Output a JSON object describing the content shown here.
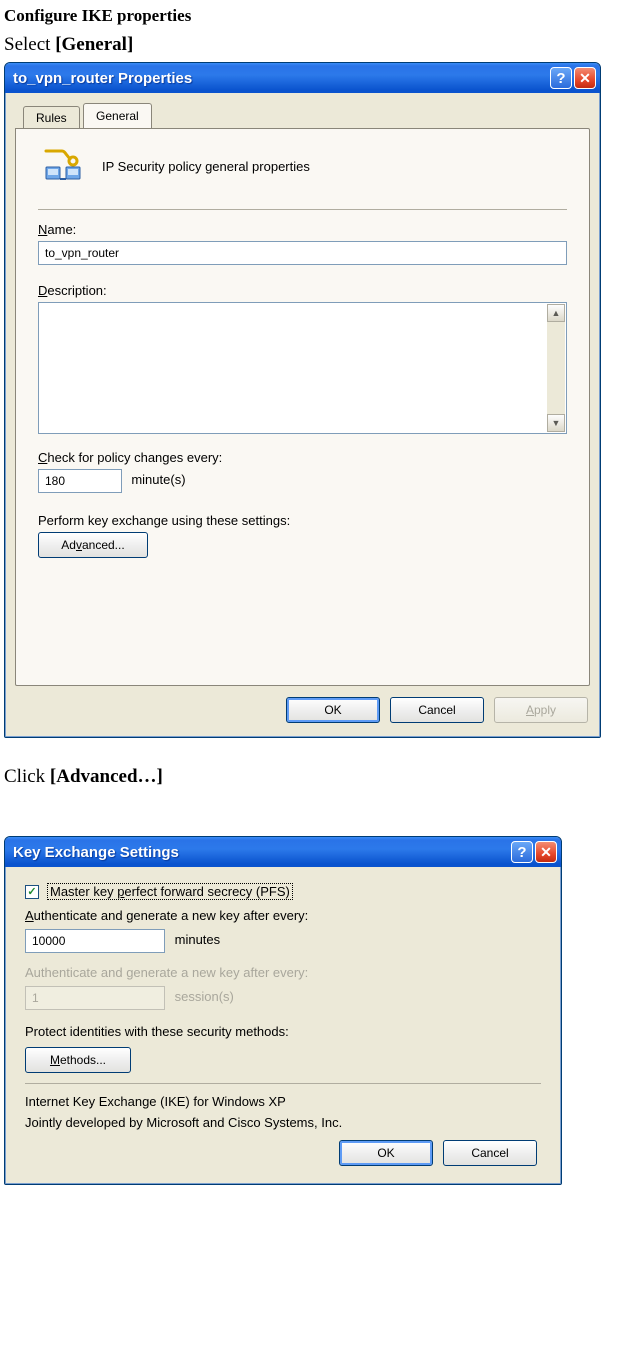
{
  "headings": {
    "configure": "Configure IKE properties",
    "select_prefix": "Select ",
    "select_bold": "[General]",
    "click_prefix": "Click ",
    "click_bold": "[Advanced…]"
  },
  "dlg1": {
    "title": "to_vpn_router Properties",
    "tabs": {
      "rules": "Rules",
      "general": "General"
    },
    "header_text": "IP Security policy general properties",
    "name_label_pre": "N",
    "name_label_rest": "ame:",
    "name_value": "to_vpn_router",
    "desc_label_pre": "D",
    "desc_label_rest": "escription:",
    "check_label_pre": "C",
    "check_label_rest": "heck for policy changes every:",
    "check_value": "180",
    "minutes": "minute(s)",
    "perform_text": "Perform key exchange using these settings:",
    "advanced_pre": "Ad",
    "advanced_u": "v",
    "advanced_rest": "anced...",
    "ok": "OK",
    "cancel": "Cancel",
    "apply_pre": "A",
    "apply_rest": "pply"
  },
  "dlg2": {
    "title": "Key Exchange Settings",
    "pfs_pre": "Master key ",
    "pfs_u": "p",
    "pfs_rest": "erfect forward secrecy (PFS)",
    "auth1_pre": "A",
    "auth1_rest": "uthenticate and generate a new key after every:",
    "minutes_val": "10000",
    "minutes_lbl": "minutes",
    "auth2": "Authenticate and generate a new key after every:",
    "sessions_val": "1",
    "sessions_lbl": "session(s)",
    "protect": "Protect identities with these security methods:",
    "methods_pre": "M",
    "methods_rest": "ethods...",
    "ike_line": "Internet Key Exchange (IKE) for Windows XP",
    "dev_line": "Jointly developed by Microsoft and Cisco Systems, Inc.",
    "ok": "OK",
    "cancel": "Cancel"
  }
}
